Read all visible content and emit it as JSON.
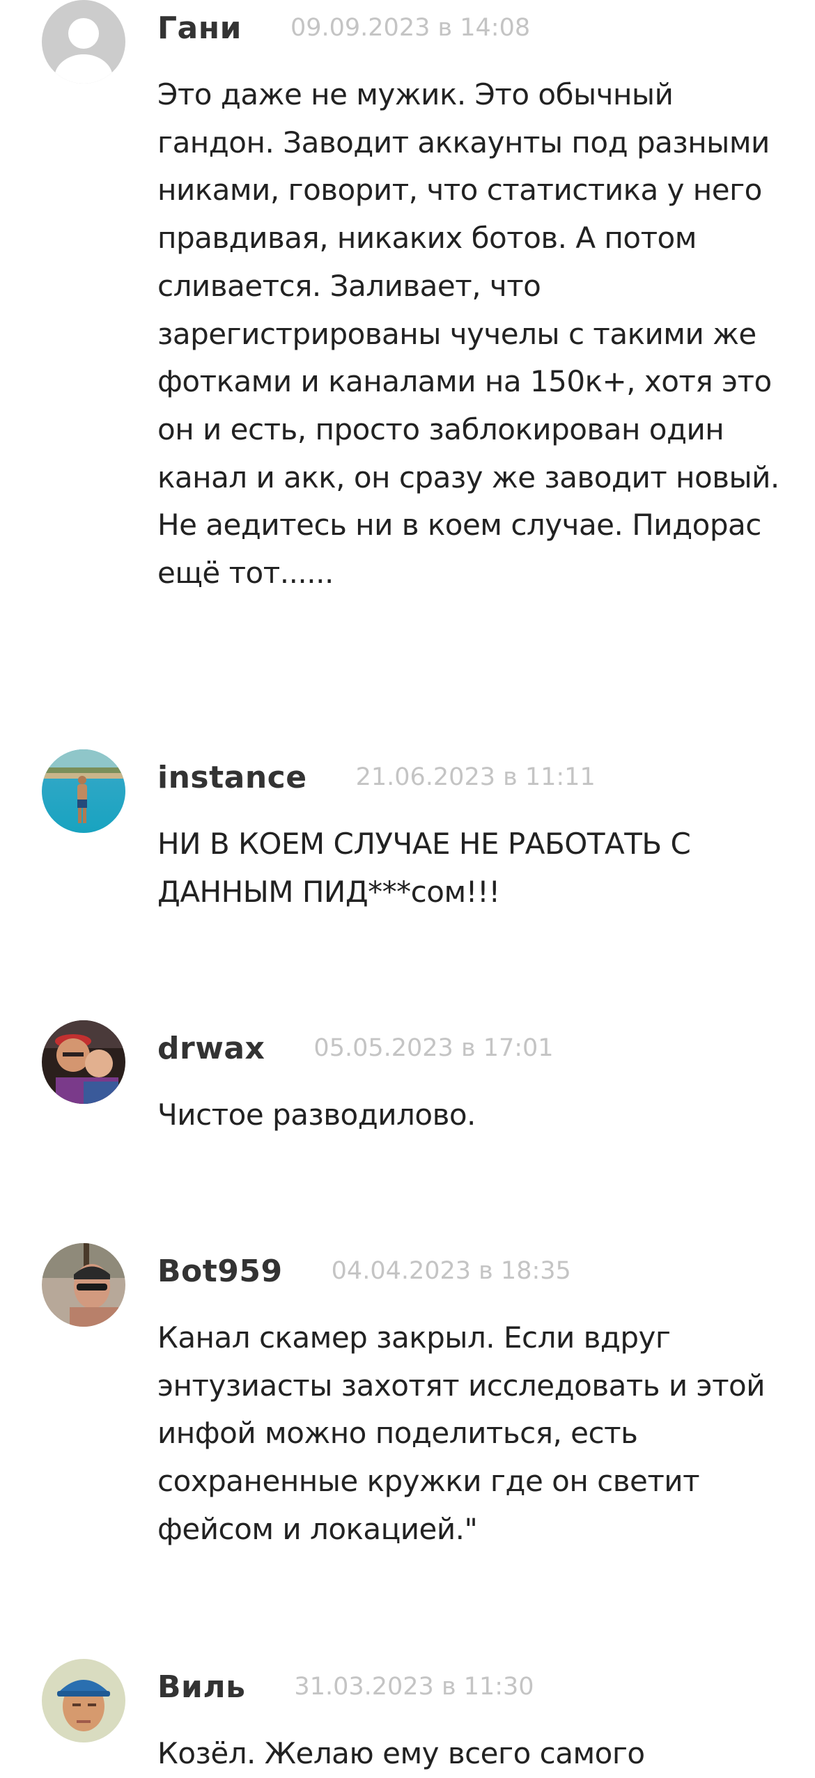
{
  "comments": [
    {
      "author": "Гани",
      "date": "09.09.2023 в 14:08",
      "avatar_type": "default-placeholder",
      "text": "Это даже не мужик. Это обычный гандон. Заводит аккаунты под разными никами, говорит, что статистика у него правдивая, никаких ботов. А потом сливается. Заливает, что зарегистрированы чучелы с такими же фотками и каналами на 150к+, хотя это он и есть, просто заблокирован один канал и акк, он сразу же заводит новый. Не аедитесь ни в коем случае. Пидорас ещё тот......"
    },
    {
      "author": "instance",
      "date": "21.06.2023 в 11:11",
      "avatar_type": "photo-pool",
      "text": "НИ В КОЕМ СЛУЧАЕ НЕ РАБОТАТЬ С ДАННЫМ ПИД***сом!!!"
    },
    {
      "author": "drwax",
      "date": "05.05.2023 в 17:01",
      "avatar_type": "photo-couple",
      "text": "Чистое разводилово."
    },
    {
      "author": "Bot959",
      "date": "04.04.2023 в 18:35",
      "avatar_type": "photo-man-sunglasses",
      "text": "Канал скамер закрыл. Если вдруг энтузиасты захотят исследовать и этой инфой можно поделиться, есть сохраненные кружки где он светит фейсом и локацией.\""
    },
    {
      "author": "Виль",
      "date": "31.03.2023 в 11:30",
      "avatar_type": "photo-man-cap",
      "text": "Козёл. Желаю ему всего самого"
    }
  ],
  "colors": {
    "author": "#333333",
    "date": "#c4c4c4",
    "text": "#222222",
    "background": "#ffffff"
  }
}
